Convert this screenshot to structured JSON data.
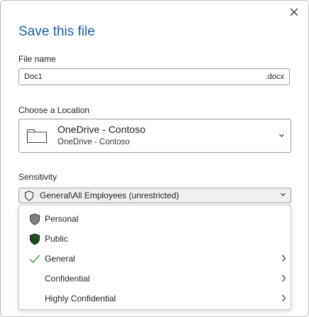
{
  "dialog": {
    "title": "Save this file",
    "close_icon": "close-icon"
  },
  "file_name": {
    "label": "File name",
    "value": "Doc1",
    "extension": ".docx"
  },
  "location": {
    "label": "Choose a Location",
    "name": "OneDrive - Contoso",
    "subtitle": "OneDrive - Contoso",
    "icon": "folder-icon"
  },
  "sensitivity": {
    "label": "Sensitivity",
    "selected": "General\\All Employees (unrestricted)",
    "menu": [
      {
        "label": "Personal",
        "icon": "shield-gray-icon",
        "submenu": false
      },
      {
        "label": "Public",
        "icon": "shield-green-icon",
        "submenu": false
      },
      {
        "label": "General",
        "icon": "checkmark-icon",
        "submenu": true
      },
      {
        "label": "Confidential",
        "icon": "",
        "submenu": true
      },
      {
        "label": "Highly Confidential",
        "icon": "",
        "submenu": true
      }
    ]
  },
  "colors": {
    "title": "#1b5fae",
    "shield_gray": "#808080",
    "shield_green": "#1e4d1e",
    "check": "#3aa655"
  }
}
